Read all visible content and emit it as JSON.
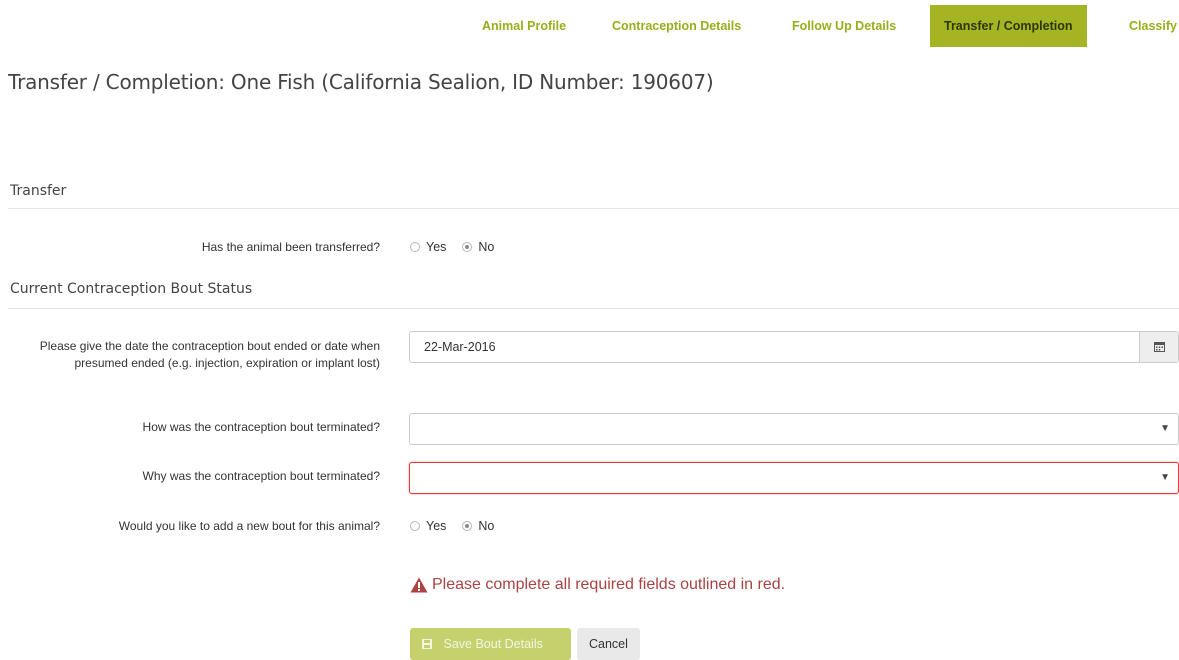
{
  "tabs": [
    {
      "label": "Animal Profile"
    },
    {
      "label": "Contraception Details"
    },
    {
      "label": "Follow Up Details"
    },
    {
      "label": "Transfer / Completion",
      "active": true
    },
    {
      "label": "Classify"
    }
  ],
  "page": {
    "title": "Transfer / Completion: One Fish (California Sealion, ID Number: 190607)"
  },
  "transfer": {
    "section_title": "Transfer",
    "question": "Has the animal been transferred?",
    "options": [
      "Yes",
      "No"
    ],
    "selected": "No"
  },
  "bout_status": {
    "section_title": "Current Contraception Bout Status",
    "end_date": {
      "label": "Please give the date the contraception bout ended or date when presumed ended (e.g. injection, expiration or implant lost)",
      "value": "22-Mar-2016",
      "icon": "calendar-icon"
    },
    "how_terminated": {
      "label": "How was the contraception bout terminated?",
      "value": ""
    },
    "why_terminated": {
      "label": "Why was the contraception bout terminated?",
      "value": "",
      "error": true
    },
    "new_bout": {
      "question": "Would you like to add a new bout for this animal?",
      "options": [
        "Yes",
        "No"
      ],
      "selected": "No"
    }
  },
  "validation": {
    "message": "Please complete all required fields outlined in red.",
    "icon": "warning-icon",
    "color": "#a94442"
  },
  "actions": {
    "save_label": "Save Bout Details",
    "cancel_label": "Cancel"
  },
  "colors": {
    "accent": "#a5b422",
    "tab_text": "#9aad1d",
    "error": "#e23b3b"
  }
}
